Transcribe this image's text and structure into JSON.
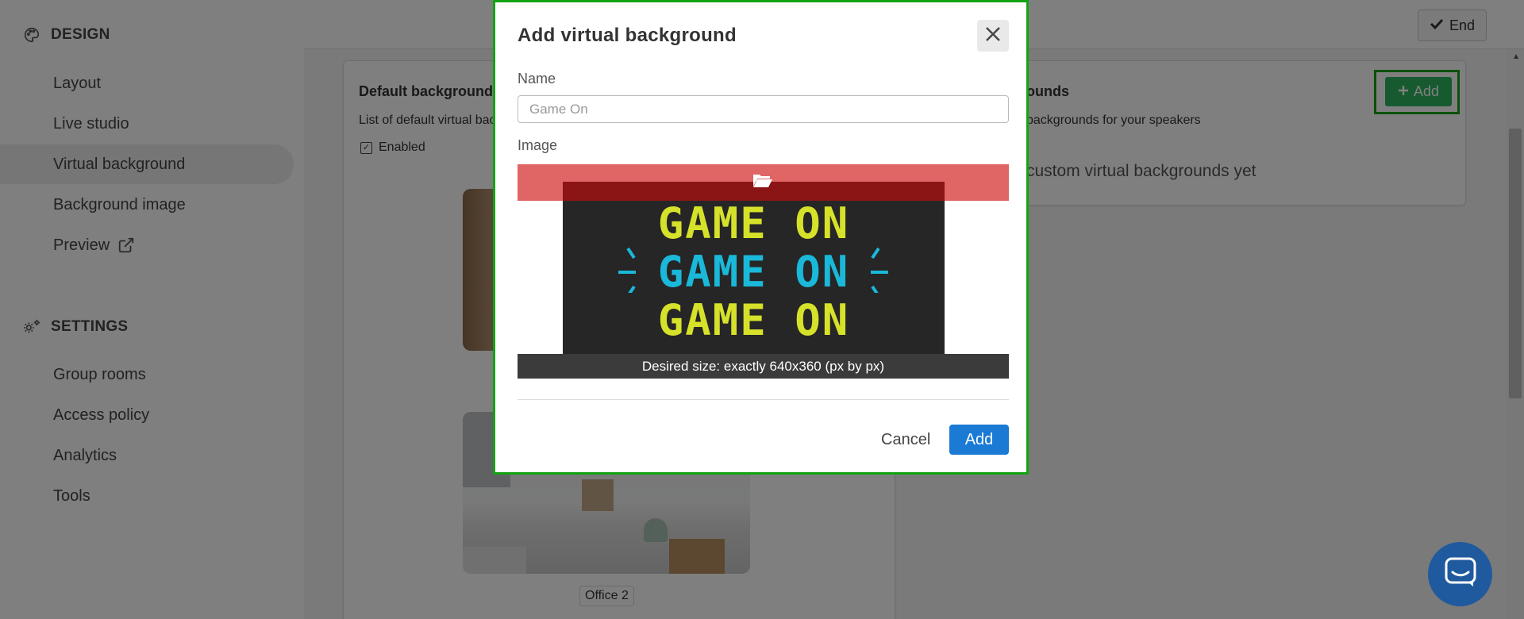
{
  "sidebar": {
    "design_section": "DESIGN",
    "design_items": [
      {
        "label": "Layout"
      },
      {
        "label": "Live studio"
      },
      {
        "label": "Virtual background"
      },
      {
        "label": "Background image"
      },
      {
        "label": "Preview"
      }
    ],
    "settings_section": "SETTINGS",
    "settings_items": [
      {
        "label": "Group rooms"
      },
      {
        "label": "Access policy"
      },
      {
        "label": "Analytics"
      },
      {
        "label": "Tools"
      }
    ]
  },
  "topbar": {
    "end_label": "End"
  },
  "default_card": {
    "title": "Default backgrounds",
    "description": "List of default virtual bac",
    "enabled_label": "Enabled",
    "thumb_label": "Office 2"
  },
  "custom_card": {
    "title": "ounds",
    "description": "backgrounds for your speakers",
    "empty_text": "custom virtual backgrounds yet",
    "add_label": "Add"
  },
  "modal": {
    "title": "Add virtual background",
    "name_label": "Name",
    "name_placeholder": "Game On",
    "image_label": "Image",
    "preview_lines": [
      "GAME ON",
      "GAME ON",
      "GAME ON"
    ],
    "size_hint": "Desired size: exactly 640x360 (px by px)",
    "cancel_label": "Cancel",
    "add_label": "Add"
  },
  "colors": {
    "accent_green": "#2fb461",
    "primary_blue": "#1a7ad4",
    "highlight": "#13a313",
    "game_yellow": "#d6e12a",
    "game_cyan": "#1ab8d9"
  }
}
